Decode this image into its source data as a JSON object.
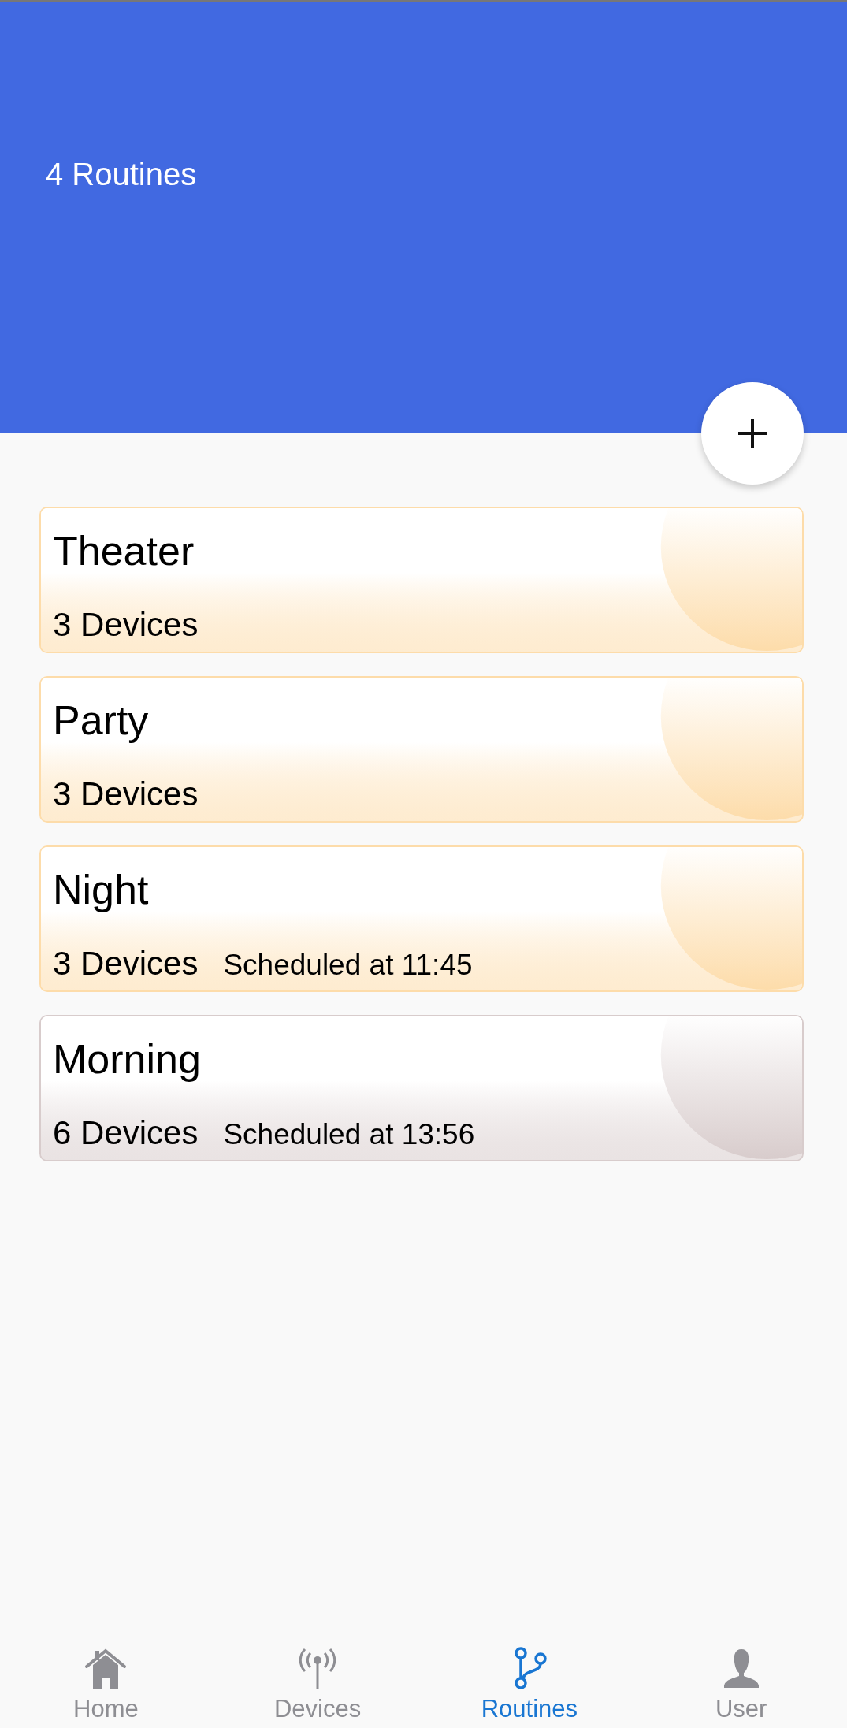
{
  "header": {
    "title": "4 Routines"
  },
  "routines": [
    {
      "name": "Theater",
      "devices": "3 Devices",
      "color": "#fddcaa"
    },
    {
      "name": "Party",
      "devices": "3 Devices",
      "color": "#fddcaa"
    },
    {
      "name": "Night",
      "devices": "3 Devices",
      "schedule": "Scheduled at 11:45",
      "color": "#fddcaa"
    },
    {
      "name": "Morning",
      "devices": "6 Devices",
      "schedule": "Scheduled at 13:56",
      "color": "#d8cccc"
    }
  ],
  "nav": [
    {
      "kind": "home",
      "label": "Home",
      "selected": false
    },
    {
      "kind": "devices",
      "label": "Devices",
      "selected": false
    },
    {
      "kind": "routines",
      "label": "Routines",
      "selected": true
    },
    {
      "kind": "user",
      "label": "User",
      "selected": false
    }
  ]
}
